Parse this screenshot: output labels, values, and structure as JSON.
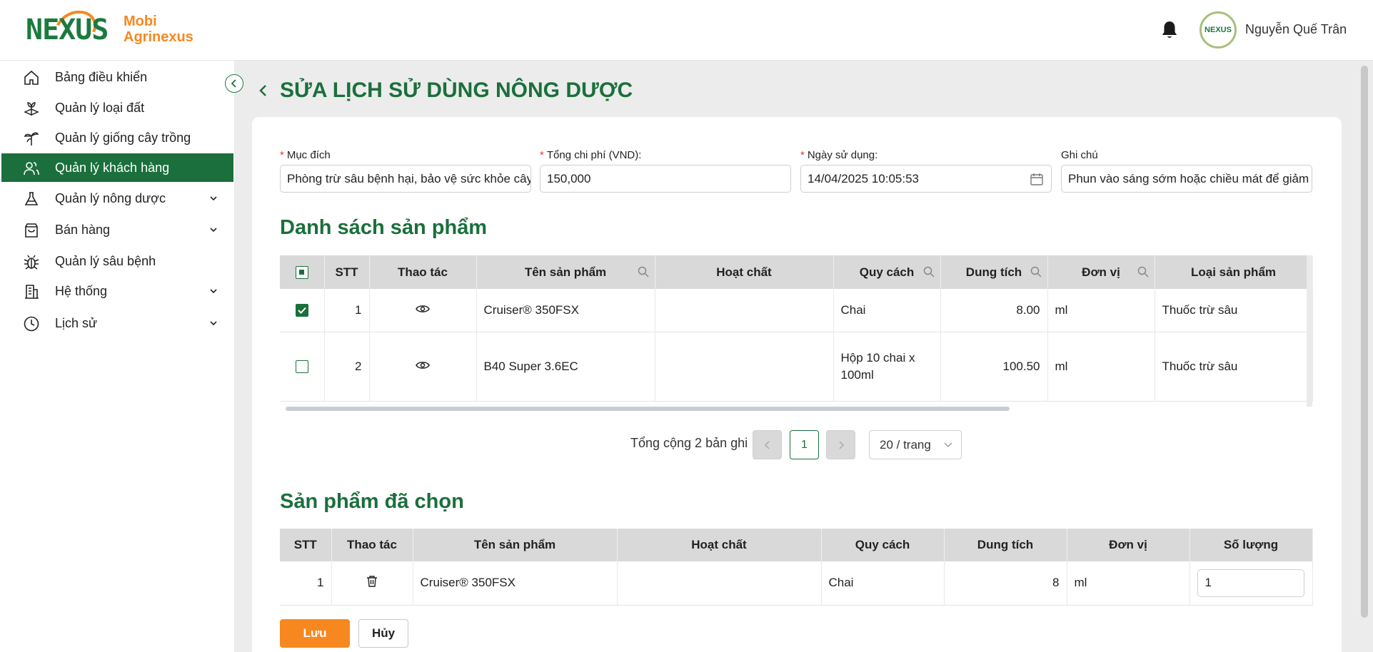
{
  "header": {
    "logo_mark": "NEXUS",
    "logo_line1": "Mobi",
    "logo_line2": "Agrinexus",
    "avatar_text": "NEXUS",
    "user_name": "Nguyễn Quế Trân"
  },
  "sidebar": {
    "items": [
      {
        "label": "Bảng điều khiển",
        "icon": "home-icon"
      },
      {
        "label": "Quản lý loại đất",
        "icon": "soil-icon"
      },
      {
        "label": "Quản lý giống cây trồng",
        "icon": "plant-icon"
      },
      {
        "label": "Quản lý khách hàng",
        "icon": "users-icon",
        "active": true
      },
      {
        "label": "Quản lý nông dược",
        "icon": "flask-icon",
        "expandable": true
      },
      {
        "label": "Bán hàng",
        "icon": "shopping-bag-icon",
        "expandable": true
      },
      {
        "label": "Quản lý sâu bệnh",
        "icon": "bug-icon"
      },
      {
        "label": "Hệ thống",
        "icon": "building-icon",
        "expandable": true
      },
      {
        "label": "Lịch sử",
        "icon": "clock-icon",
        "expandable": true
      }
    ]
  },
  "page": {
    "title": "SỬA LỊCH SỬ DÙNG NÔNG DƯỢC"
  },
  "form": {
    "purpose_label": "Mục đích",
    "purpose_value": "Phòng trừ sâu bệnh hại, bảo vệ sức khỏe cây trồng",
    "cost_label": "Tổng chi phí (VND):",
    "cost_value": "150,000",
    "date_label": "Ngày sử dụng:",
    "date_value": "14/04/2025 10:05:53",
    "note_label": "Ghi chú",
    "note_value": "Phun vào sáng sớm hoặc chiều mát để giảm bay hơi"
  },
  "products": {
    "title": "Danh sách sản phẩm",
    "columns": {
      "stt": "STT",
      "action": "Thao tác",
      "name": "Tên sản phẩm",
      "ingredient": "Hoạt chất",
      "spec": "Quy cách",
      "volume": "Dung tích",
      "unit": "Đơn vị",
      "type": "Loại sản phẩm"
    },
    "rows": [
      {
        "checked": true,
        "stt": "1",
        "name": "Cruiser® 350FSX",
        "ingredient": "",
        "spec": "Chai",
        "volume": "8.00",
        "unit": "ml",
        "type": "Thuốc trừ sâu"
      },
      {
        "checked": false,
        "stt": "2",
        "name": "B40 Super 3.6EC",
        "ingredient": "",
        "spec": "Hộp 10 chai x 100ml",
        "volume": "100.50",
        "unit": "ml",
        "type": "Thuốc trừ sâu"
      }
    ]
  },
  "pagination": {
    "total": "Tổng cộng 2 bản ghi",
    "page": "1",
    "page_size": "20 / trang"
  },
  "selected": {
    "title": "Sản phẩm đã chọn",
    "columns": {
      "stt": "STT",
      "action": "Thao tác",
      "name": "Tên sản phẩm",
      "ingredient": "Hoạt chất",
      "spec": "Quy cách",
      "volume": "Dung tích",
      "unit": "Đơn vị",
      "qty": "Số lượng"
    },
    "rows": [
      {
        "stt": "1",
        "name": "Cruiser® 350FSX",
        "ingredient": "",
        "spec": "Chai",
        "volume": "8",
        "unit": "ml",
        "qty": "1"
      }
    ]
  },
  "actions": {
    "save_label": "Lưu",
    "cancel_label": "Hủy"
  },
  "colors": {
    "brand_green": "#1b6f3c",
    "brand_orange": "#f6881f"
  }
}
